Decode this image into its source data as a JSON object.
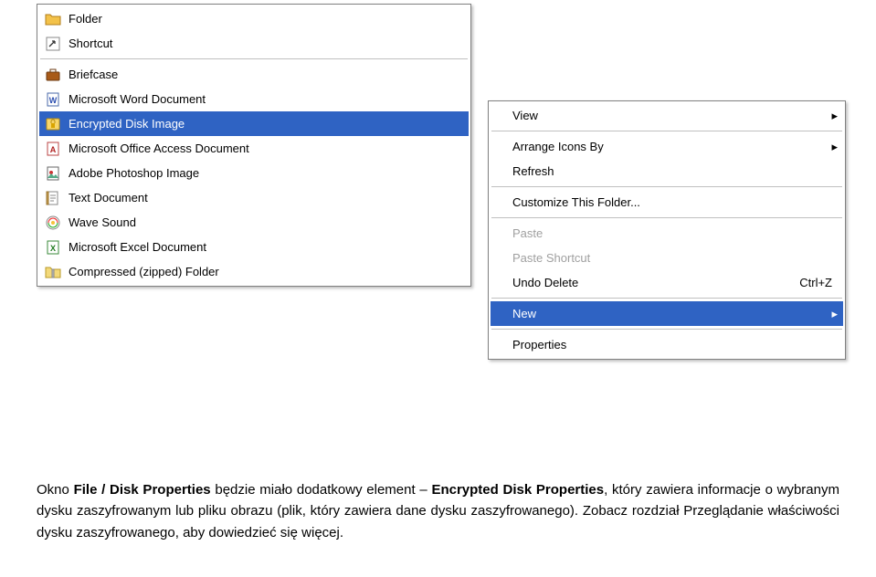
{
  "submenu_new": {
    "items": [
      {
        "label": "Folder",
        "icon": "folder-icon",
        "selected": false,
        "submenu": false
      },
      {
        "label": "Shortcut",
        "icon": "shortcut-icon",
        "selected": false,
        "submenu": false
      },
      {
        "sep": true
      },
      {
        "label": "Briefcase",
        "icon": "briefcase-icon",
        "selected": false,
        "submenu": false
      },
      {
        "label": "Microsoft Word Document",
        "icon": "word-doc-icon",
        "selected": false,
        "submenu": false
      },
      {
        "label": "Encrypted Disk Image",
        "icon": "encrypted-disk-icon",
        "selected": true,
        "submenu": false
      },
      {
        "label": "Microsoft Office Access Document",
        "icon": "access-doc-icon",
        "selected": false,
        "submenu": false
      },
      {
        "label": "Adobe Photoshop Image",
        "icon": "photoshop-icon",
        "selected": false,
        "submenu": false
      },
      {
        "label": "Text Document",
        "icon": "text-doc-icon",
        "selected": false,
        "submenu": false
      },
      {
        "label": "Wave Sound",
        "icon": "wave-sound-icon",
        "selected": false,
        "submenu": false
      },
      {
        "label": "Microsoft Excel Document",
        "icon": "excel-doc-icon",
        "selected": false,
        "submenu": false
      },
      {
        "label": "Compressed (zipped) Folder",
        "icon": "zip-folder-icon",
        "selected": false,
        "submenu": false
      }
    ]
  },
  "context_menu": {
    "items": [
      {
        "label": "View",
        "submenu": true,
        "selected": false,
        "disabled": false
      },
      {
        "sep": true
      },
      {
        "label": "Arrange Icons By",
        "submenu": true,
        "selected": false,
        "disabled": false
      },
      {
        "label": "Refresh",
        "submenu": false,
        "selected": false,
        "disabled": false
      },
      {
        "sep": true
      },
      {
        "label": "Customize This Folder...",
        "submenu": false,
        "selected": false,
        "disabled": false
      },
      {
        "sep": true
      },
      {
        "label": "Paste",
        "submenu": false,
        "selected": false,
        "disabled": true
      },
      {
        "label": "Paste Shortcut",
        "submenu": false,
        "selected": false,
        "disabled": true
      },
      {
        "label": "Undo Delete",
        "submenu": false,
        "selected": false,
        "disabled": false,
        "shortcut": "Ctrl+Z"
      },
      {
        "sep": true
      },
      {
        "label": "New",
        "submenu": true,
        "selected": true,
        "disabled": false
      },
      {
        "sep": true
      },
      {
        "label": "Properties",
        "submenu": false,
        "selected": false,
        "disabled": false
      }
    ]
  },
  "caption": {
    "t1": "Okno ",
    "b1": "File / Disk Properties",
    "t2": " będzie miało dodatkowy element – ",
    "b2": "Encrypted Disk Properties",
    "t3": ", który zawiera informacje o wybranym dysku zaszyfrowanym lub pliku obrazu (plik, który zawiera dane dysku zaszyfrowanego). Zobacz rozdział Przeglądanie właściwości dysku zaszyfrowanego, aby dowiedzieć się więcej."
  }
}
